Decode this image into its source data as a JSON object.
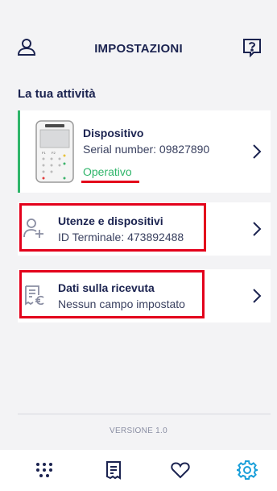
{
  "header": {
    "title": "IMPOSTAZIONI",
    "user_icon": "user-icon",
    "help_icon": "help-icon"
  },
  "section_title": "La tua attività",
  "device_card": {
    "name": "Dispositivo",
    "serial": "Serial number: 09827890",
    "status": "Operativo",
    "status_color": "#2fb56a",
    "icon": "pos-terminal-image"
  },
  "users_card": {
    "title": "Utenze e dispositivi",
    "subtitle": "ID Terminale: 473892488",
    "icon": "add-user-icon"
  },
  "receipt_card": {
    "title": "Dati sulla ricevuta",
    "subtitle": "Nessun campo impostato",
    "icon": "receipt-euro-icon"
  },
  "version": "VERSIONE 1.0",
  "tabbar": {
    "items": [
      {
        "icon": "grid-dots-icon",
        "active": false
      },
      {
        "icon": "receipt-icon",
        "active": false
      },
      {
        "icon": "heart-icon",
        "active": false
      },
      {
        "icon": "gear-icon",
        "active": true
      }
    ]
  },
  "colors": {
    "primary": "#1b2350",
    "accent_blue": "#1a9fd9",
    "success": "#2fb56a",
    "highlight_red": "#e3001b",
    "background": "#f3f3f5"
  }
}
